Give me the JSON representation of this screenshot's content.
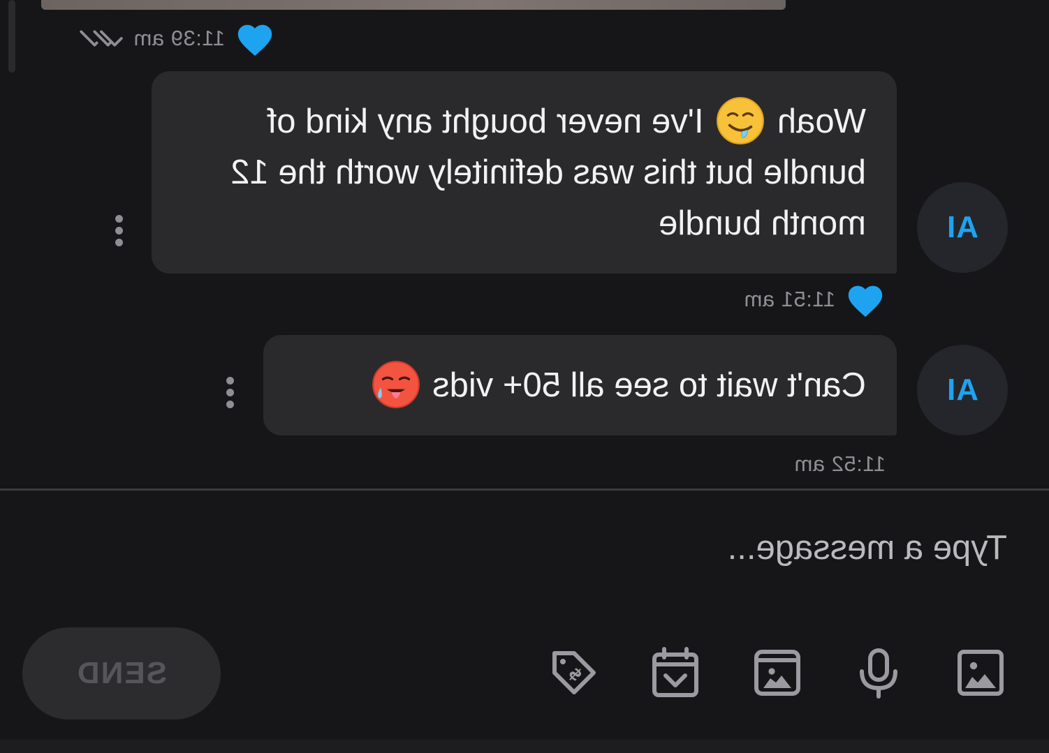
{
  "colors": {
    "background": "#161618",
    "bubble": "#2a2a2d",
    "accent": "#1ea3f0",
    "meta_text": "#8e8e93"
  },
  "thread": {
    "previous_message": {
      "time": "11:39 am",
      "liked": true,
      "status_icon": "double-check-icon"
    },
    "messages": [
      {
        "avatar_initials": "AI",
        "text_before_emoji": "Woah",
        "emoji": "drooling-face-emoji",
        "text_after_emoji": "I've never bought any kind of bundle but this was definitely worth the 12 month bundle",
        "time": "11:51 am",
        "liked": true
      },
      {
        "avatar_initials": "AI",
        "text": "Can't wait to see all 50+ vids",
        "emoji": "hot-face-emoji",
        "time": "11:52 am",
        "liked": false
      }
    ]
  },
  "composer": {
    "placeholder": "Type a message...",
    "toolbar": [
      {
        "name": "image-icon"
      },
      {
        "name": "microphone-icon"
      },
      {
        "name": "vault-icon"
      },
      {
        "name": "schedule-icon"
      },
      {
        "name": "price-tag-icon"
      }
    ],
    "send_label": "SEND"
  }
}
